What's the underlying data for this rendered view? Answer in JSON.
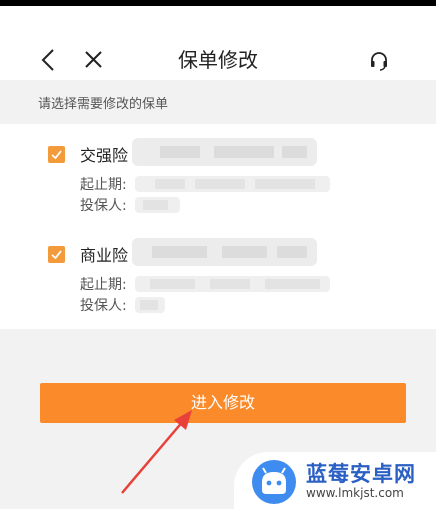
{
  "nav": {
    "title": "保单修改",
    "back_icon": "chevron-left-icon",
    "close_icon": "close-icon",
    "support_icon": "headset-icon"
  },
  "section": {
    "prompt": "请选择需要修改的保单"
  },
  "policies": [
    {
      "type": "交强险",
      "checked": true,
      "period_label": "起止期:",
      "insured_label": "投保人:"
    },
    {
      "type": "商业险",
      "checked": true,
      "period_label": "起止期:",
      "insured_label": "投保人:"
    }
  ],
  "actions": {
    "submit_label": "进入修改"
  },
  "watermark": {
    "name": "蓝莓安卓网",
    "url": "www.lmkjst.com"
  },
  "colors": {
    "accent": "#fb8a2a",
    "checkbox": "#f39a3a",
    "annotation_arrow": "#e8413a",
    "watermark_blue": "#2a5fc4"
  }
}
